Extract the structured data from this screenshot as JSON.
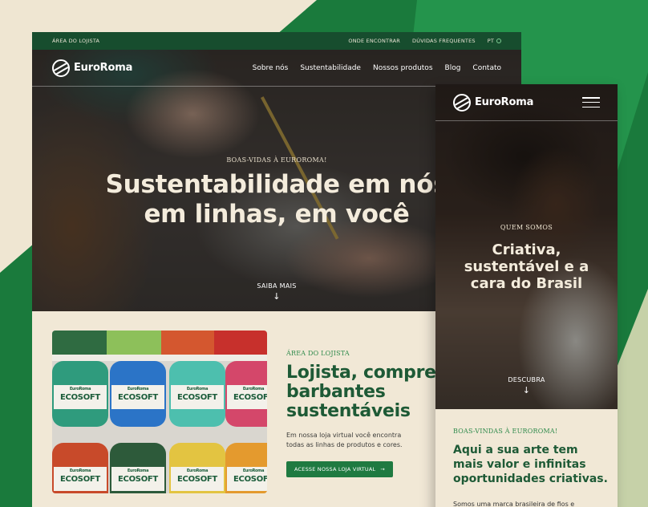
{
  "desktop": {
    "topbar": {
      "left": "ÁREA DO LOJISTA",
      "links": [
        "ONDE ENCONTRAR",
        "DÚVIDAS FREQUENTES"
      ],
      "language": "PT"
    },
    "brand": "EuroRoma",
    "menu": [
      "Sobre nós",
      "Sustentabilidade",
      "Nossos produtos",
      "Blog",
      "Contato"
    ],
    "hero": {
      "eyebrow": "BOAS-VIDAS À EUROROMA!",
      "title_line1": "Sustentabilidade em nós",
      "title_line2": "em linhas, em você",
      "cta": "SAIBA MAIS"
    },
    "retailer": {
      "eyebrow": "ÁREA DO LOJISTA",
      "title_line1": "Lojista, compre",
      "title_line2": "barbantes",
      "title_line3": "sustentáveis",
      "description": "Em nossa loja virtual você encontra todas as linhas de produtos e cores.",
      "button": "ACESSE NOSSA LOJA VIRTUAL"
    },
    "product_label": "ECOSOFT",
    "product_brand": "EuroRoma"
  },
  "mobile": {
    "brand": "EuroRoma",
    "hero": {
      "eyebrow": "QUEM SOMOS",
      "title_line1": "Criativa,",
      "title_line2": "sustentável e a",
      "title_line3": "cara do Brasil",
      "cta": "DESCUBRA"
    },
    "welcome": {
      "eyebrow": "BOAS-VINDAS À EUROROMA!",
      "title_line1": "Aqui a sua arte tem",
      "title_line2": "mais valor e infinitas",
      "title_line3": "oportunidades criativas.",
      "cut_text": "Somos uma marca brasileira de fios e"
    }
  },
  "colors": {
    "dark_green": "#174d2e",
    "brand_green": "#1f7a41",
    "cream": "#f1e8d6",
    "headline_green": "#1e5a36"
  }
}
